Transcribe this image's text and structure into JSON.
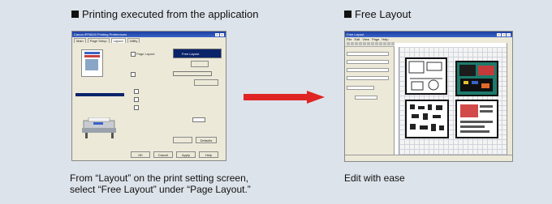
{
  "left": {
    "heading": "Printing executed from the application",
    "caption_line1": "From “Layout” on the print setting screen,",
    "caption_line2": "select “Free Layout” under “Page Layout.”",
    "dialog": {
      "title": "Canon iPF6000 Printing Preferences",
      "tabs": [
        "Main",
        "Page Setup",
        "Layout",
        "Utility"
      ],
      "page_layout_label": "Page Layout",
      "page_layout_value": "Free Layout",
      "buttons": [
        "OK",
        "Cancel",
        "Apply",
        "Help"
      ],
      "defaults_label": "Defaults"
    }
  },
  "right": {
    "heading": "Free Layout",
    "caption": "Edit with ease",
    "window": {
      "title": "Free Layout",
      "menu": [
        "File",
        "Edit",
        "View",
        "Page",
        "Help"
      ]
    }
  },
  "colors": {
    "arrow": "#e02424",
    "background": "#dde3ea",
    "selection": "#0a246a"
  }
}
